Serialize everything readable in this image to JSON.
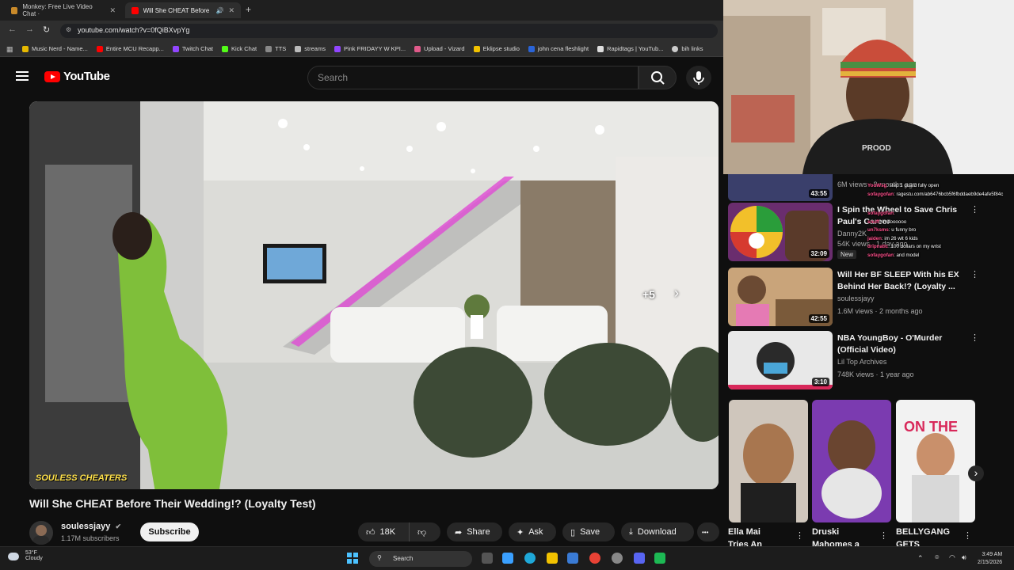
{
  "browser": {
    "tabs": [
      {
        "label": "Monkey: Free Live Video Chat ·",
        "active": false
      },
      {
        "label": "Will She CHEAT Before The",
        "active": true
      }
    ],
    "new_tab": "+",
    "url": "youtube.com/watch?v=0fQiBXvpYg",
    "bookmarks": [
      "Music Nerd - Name...",
      "Entire MCU Recapp...",
      "Twitch Chat",
      "Kick Chat",
      "TTS",
      "streams",
      "Pink FRIDAYY W KPI...",
      "Upload - Vizard",
      "Eklipse studio",
      "john cena fleshlight",
      "Rapidtags | YouTub...",
      "bih links"
    ]
  },
  "youtube": {
    "logo_text": "YouTube",
    "search_placeholder": "Search"
  },
  "video": {
    "title": "Will She CHEAT Before Their Wedding!? (Loyalty Test)",
    "overlay_skip": "+5",
    "watermark": "SOULESS CHEATERS",
    "channel": {
      "name": "soulessjayy",
      "subscribers": "1.17M subscribers",
      "subscribe_label": "Subscribe"
    },
    "actions": {
      "likes": "18K",
      "share": "Share",
      "ask": "Ask",
      "save": "Save",
      "download": "Download",
      "more": "•••"
    }
  },
  "recommendations": [
    {
      "title": "",
      "channel": "",
      "meta": "6M views · 8 months ago",
      "duration": "43:55"
    },
    {
      "title": "I Spin the Wheel to Save Chris Paul's Career",
      "channel": "Danny2K",
      "meta": "54K views · 1 day ago",
      "badge": "New",
      "duration": "32:09"
    },
    {
      "title": "Will Her BF SLEEP With his EX Behind Her Back!? (Loyalty ...",
      "channel": "soulessjayy",
      "meta": "1.6M views · 2 months ago",
      "duration": "42:55"
    },
    {
      "title": "NBA YoungBoy - O'Murder (Official Video)",
      "channel": "Lil Top Archives",
      "meta": "748K views · 1 year ago",
      "duration": "3:10"
    }
  ],
  "shorts": [
    {
      "title": "Ella Mai",
      "subtitle": "Tries An"
    },
    {
      "title": "Druski",
      "subtitle": "Mahomes a"
    },
    {
      "title": "BELLYGANG",
      "subtitle": "GETS"
    }
  ],
  "chat": [
    {
      "user": "YooWsg",
      "msg": "step 1 guard fully open"
    },
    {
      "user": "sofaygofan",
      "msg": "ragestu.com/ab6476bcb5f6fbddaeb9de4afe5f84c"
    },
    {
      "user": "sofaygofan",
      "msg": ""
    },
    {
      "user": "snuff",
      "msg": "lmaoooooo"
    },
    {
      "user": "un7ksms",
      "msg": "u funny bro"
    },
    {
      "user": "jaiden",
      "msg": "im 26 wit 6 kids"
    },
    {
      "user": "dripnatic",
      "msg": "100 dollars on my wrist"
    },
    {
      "user": "sofaygofan",
      "msg": "and model"
    }
  ],
  "taskbar": {
    "weather_temp": "53°F",
    "weather_desc": "Cloudy",
    "search": "Search",
    "time": "3:49 AM",
    "date": "2/15/2026"
  }
}
